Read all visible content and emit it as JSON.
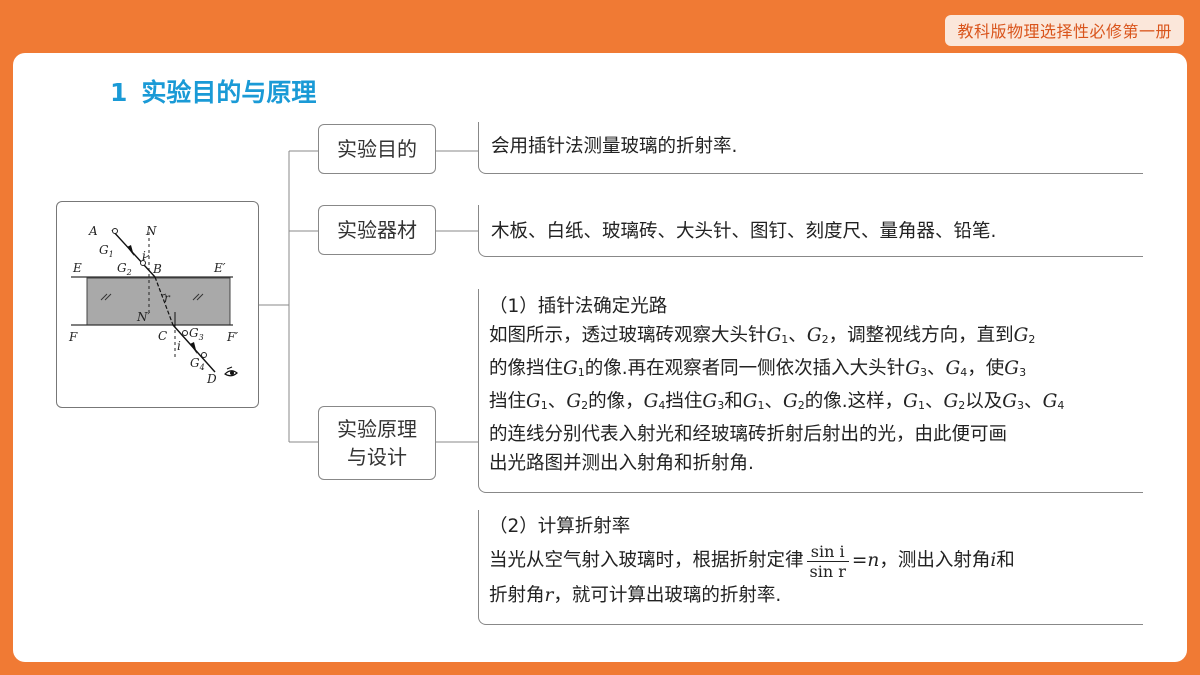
{
  "header": {
    "badge": "教科版物理选择性必修第一册"
  },
  "title": {
    "num": "1",
    "text": "实验目的与原理"
  },
  "figure": {
    "labels": {
      "A": "A",
      "N": "N",
      "G1": "G",
      "G1_sub": "1",
      "G2": "G",
      "G2_sub": "2",
      "i_top": "i",
      "B": "B",
      "E": "E",
      "E_prime": "E′",
      "r": "r",
      "N_prime": "N′",
      "F": "F",
      "C": "C",
      "G3": "G",
      "G3_sub": "3",
      "F_prime": "F′",
      "i_bottom": "i",
      "G4": "G",
      "G4_sub": "4",
      "D": "D"
    },
    "icons": [
      "eye-icon"
    ]
  },
  "tree": {
    "purpose": {
      "label": "实验目的",
      "text": "会用插针法测量玻璃的折射率."
    },
    "equipment": {
      "label": "实验器材",
      "text": "木板、白纸、玻璃砖、大头针、图钉、刻度尺、量角器、铅笔."
    },
    "principle": {
      "label_line1": "实验原理",
      "label_line2": "与设计",
      "part1": {
        "heading": "（1）插针法确定光路",
        "l1a": "如图所示，透过玻璃砖观察大头针",
        "l1g1": "G",
        "l1g1s": "1",
        "l1b": "、",
        "l1g2": "G",
        "l1g2s": "2",
        "l1c": "，调整视线方向，直到",
        "l1g3": "G",
        "l1g3s": "2",
        "l2a": "的像挡住",
        "l2g1": "G",
        "l2g1s": "1",
        "l2b": "的像.再在观察者同一侧依次插入大头针",
        "l2g2": "G",
        "l2g2s": "3",
        "l2c": "、",
        "l2g3": "G",
        "l2g3s": "4",
        "l2d": "，使",
        "l2g4": "G",
        "l2g4s": "3",
        "l3a": "挡住",
        "l3g1": "G",
        "l3g1s": "1",
        "l3b": "、",
        "l3g2": "G",
        "l3g2s": "2",
        "l3c": "的像，",
        "l3g3": "G",
        "l3g3s": "4",
        "l3d": "挡住",
        "l3g4": "G",
        "l3g4s": "3",
        "l3e": "和",
        "l3g5": "G",
        "l3g5s": "1",
        "l3f": "、",
        "l3g6": "G",
        "l3g6s": "2",
        "l3g": "的像.这样，",
        "l3g7": "G",
        "l3g7s": "1",
        "l3h": "、",
        "l3g8": "G",
        "l3g8s": "2",
        "l3i": "以及",
        "l3g9": "G",
        "l3g9s": "3",
        "l3j": "、",
        "l3g10": "G",
        "l3g10s": "4",
        "l4": "的连线分别代表入射光和经玻璃砖折射后射出的光，由此便可画",
        "l5": "出光路图并测出入射角和折射角."
      },
      "part2": {
        "heading": "（2）计算折射率",
        "l1a": "当光从空气射入玻璃时，根据折射定律",
        "frac_num": "sin i",
        "frac_den": "sin r",
        "l1b": "=",
        "l1n": "n",
        "l1c": "，测出入射角",
        "l1i": "i",
        "l1d": "和",
        "l2a": "折射角",
        "l2r": "r",
        "l2b": "，就可计算出玻璃的折射率."
      }
    }
  },
  "colors": {
    "accent": "#f07a34",
    "title": "#1a9ad6",
    "glass": "#a9a9a9"
  }
}
